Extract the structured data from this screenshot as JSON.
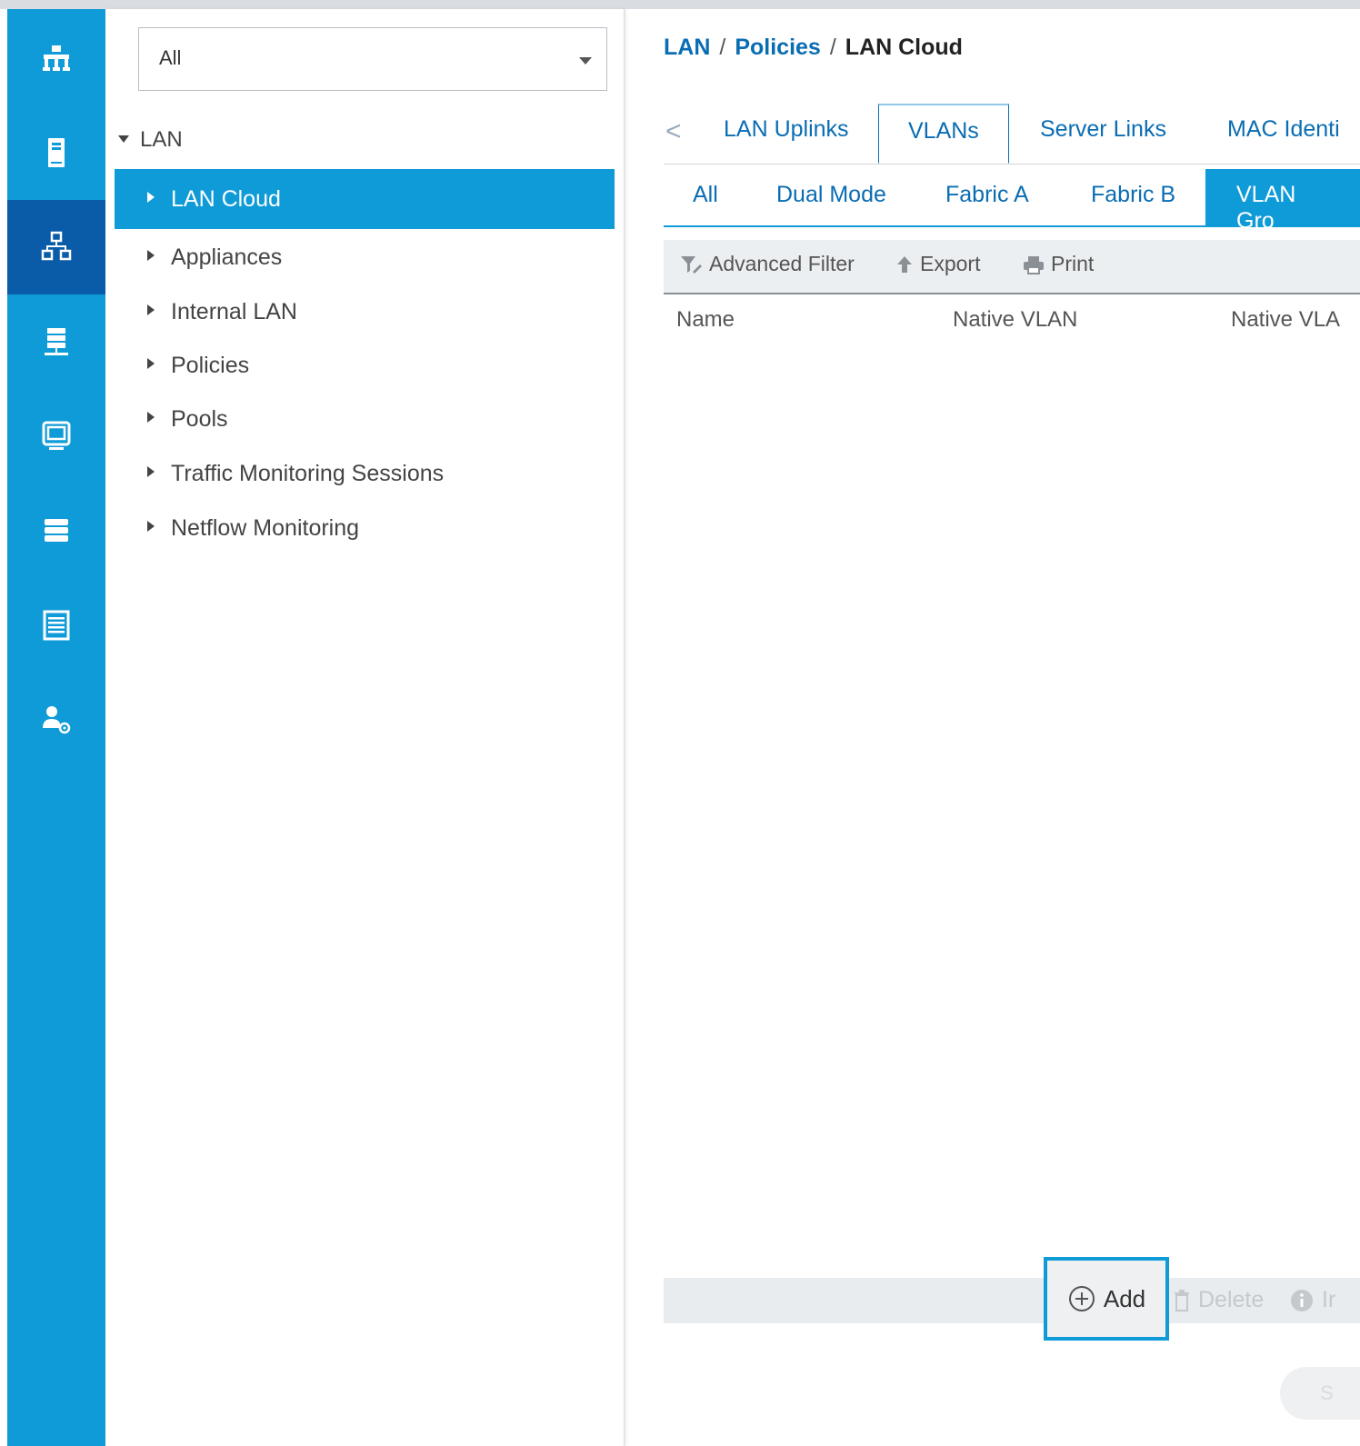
{
  "rail": {
    "items": [
      {
        "icon": "equipment-icon"
      },
      {
        "icon": "servers-icon"
      },
      {
        "icon": "lan-icon",
        "active": true
      },
      {
        "icon": "san-icon"
      },
      {
        "icon": "vm-icon"
      },
      {
        "icon": "storage-icon"
      },
      {
        "icon": "chassis-icon"
      },
      {
        "icon": "admin-icon"
      }
    ]
  },
  "nav": {
    "filter_value": "All",
    "root_label": "LAN",
    "items": [
      {
        "label": "LAN Cloud",
        "selected": true
      },
      {
        "label": "Appliances"
      },
      {
        "label": "Internal LAN"
      },
      {
        "label": "Policies"
      },
      {
        "label": "Pools"
      },
      {
        "label": "Traffic Monitoring Sessions"
      },
      {
        "label": "Netflow Monitoring"
      }
    ]
  },
  "breadcrumb": {
    "items": [
      "LAN",
      "Policies"
    ],
    "separator": "/",
    "current": "LAN Cloud"
  },
  "tabs": {
    "back_glyph": "<",
    "primary": [
      "LAN Uplinks",
      "VLANs",
      "Server Links",
      "MAC Identi"
    ],
    "primary_active": "VLANs",
    "secondary": [
      "All",
      "Dual Mode",
      "Fabric A",
      "Fabric B",
      "VLAN Gro"
    ],
    "secondary_active": "VLAN Gro"
  },
  "toolbar": {
    "advanced_filter": "Advanced Filter",
    "export": "Export",
    "print": "Print"
  },
  "table": {
    "columns": [
      "Name",
      "Native VLAN",
      "Native VLA"
    ]
  },
  "actions": {
    "add": "Add",
    "delete": "Delete",
    "info": "Ir",
    "save": "S"
  },
  "colors": {
    "accent": "#0f9bd7",
    "rail_active": "#0a5ba8",
    "link": "#0a6db3"
  }
}
